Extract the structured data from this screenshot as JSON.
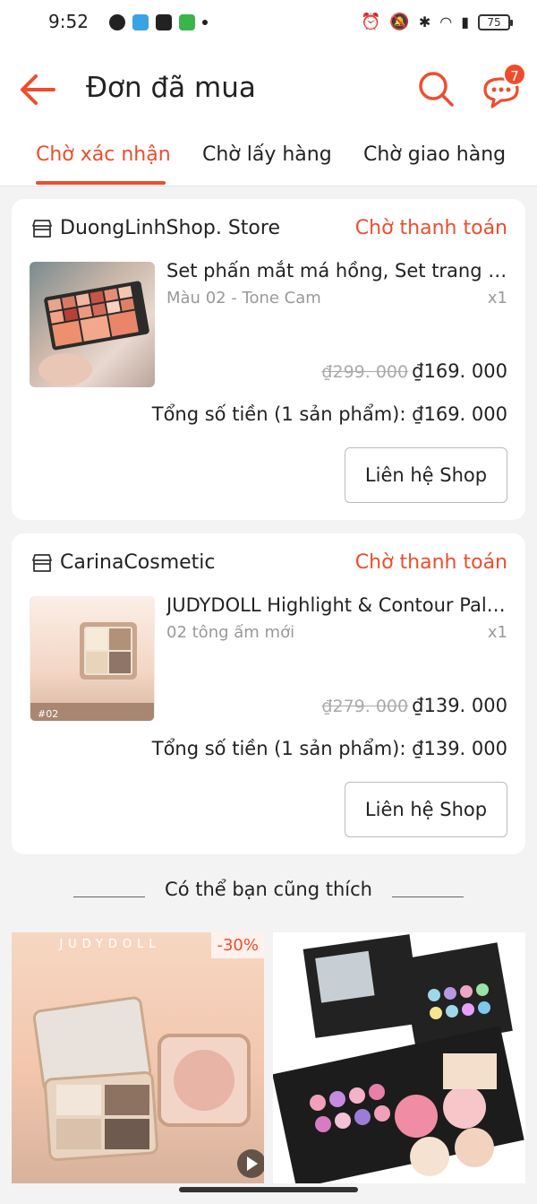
{
  "status_bar": {
    "time": "9:52",
    "battery": "75"
  },
  "header": {
    "title": "Đơn đã mua",
    "chat_badge": "7"
  },
  "tabs": [
    {
      "label": "Chờ xác nhận",
      "active": true
    },
    {
      "label": "Chờ lấy hàng",
      "active": false
    },
    {
      "label": "Chờ giao hàng",
      "active": false
    }
  ],
  "orders": [
    {
      "shop": "DuongLinhShop. Store",
      "status": "Chờ thanh toán",
      "product": "Set phấn mắt má hồng, Set trang điểm",
      "variant": "Màu 02 - Tone Cam",
      "qty": "x1",
      "old_price": "₫299. 000",
      "price": "₫169. 000",
      "total": "Tổng số tiền (1 sản phẩm): ₫169. 000",
      "button": "Liên hệ Shop"
    },
    {
      "shop": "CarinaCosmetic",
      "status": "Chờ thanh toán",
      "product": "JUDYDOLL Highlight & Contour Palette",
      "variant": "02 tông ấm mới",
      "qty": "x1",
      "old_price": "₫279. 000",
      "price": "₫139. 000",
      "total": "Tổng số tiền (1 sản phẩm): ₫139. 000",
      "button": "Liên hệ Shop"
    }
  ],
  "recommend": {
    "heading": "Có thể bạn cũng thích",
    "items": [
      {
        "brand": "JUDYDOLL",
        "discount": "-30%"
      },
      {
        "brand": ""
      }
    ]
  },
  "thumb_labels": {
    "second": "#02"
  }
}
